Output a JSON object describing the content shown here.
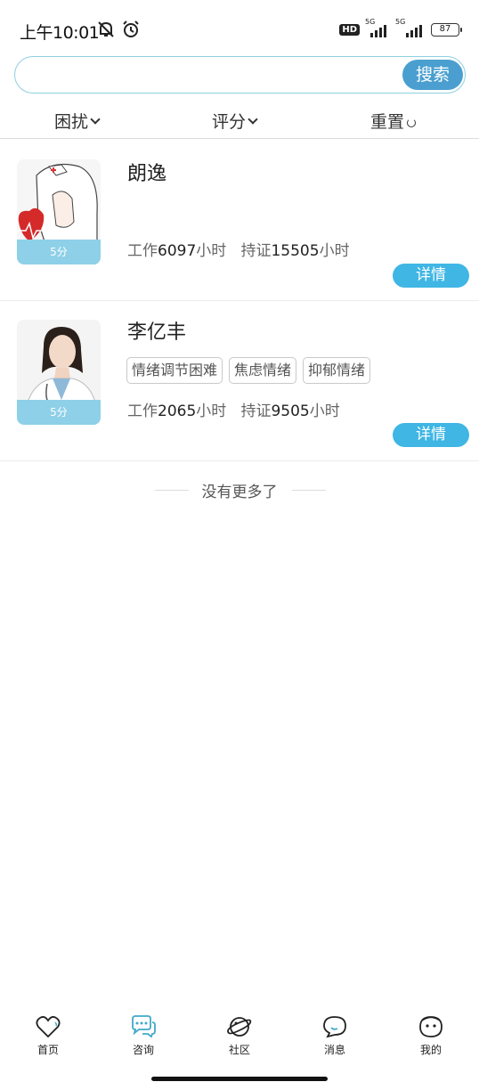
{
  "status_bar": {
    "time": "上午10:01",
    "network1": "5G",
    "network2": "5G",
    "hd": "HD",
    "battery": "87"
  },
  "search": {
    "placeholder": "",
    "value": "",
    "button_label": "搜索"
  },
  "filters": {
    "trouble_label": "困扰",
    "rating_label": "评分",
    "reset_label": "重置"
  },
  "counselors": [
    {
      "name": "朗逸",
      "score": "5分",
      "tags": [],
      "work_label": "工作",
      "work_hours": "6097",
      "hours_unit": "小时",
      "cert_label": "持证",
      "cert_hours": "15505",
      "detail_label": "详情"
    },
    {
      "name": "李亿丰",
      "score": "5分",
      "tags": [
        "情绪调节困难",
        "焦虑情绪",
        "抑郁情绪"
      ],
      "work_label": "工作",
      "work_hours": "2065",
      "hours_unit": "小时",
      "cert_label": "持证",
      "cert_hours": "9505",
      "detail_label": "详情"
    }
  ],
  "list_end_text": "没有更多了",
  "bottom_nav": {
    "items": [
      {
        "label": "首页",
        "icon": "heart-icon"
      },
      {
        "label": "咨询",
        "icon": "chat-bubbles-icon"
      },
      {
        "label": "社区",
        "icon": "planet-icon"
      },
      {
        "label": "消息",
        "icon": "message-bubble-icon"
      },
      {
        "label": "我的",
        "icon": "face-icon"
      }
    ],
    "active_color": "#3fa9c9"
  },
  "colors": {
    "accent": "#3fb6e4",
    "search_button": "#4a9fd0",
    "score_badge": "#8ed0e8"
  }
}
